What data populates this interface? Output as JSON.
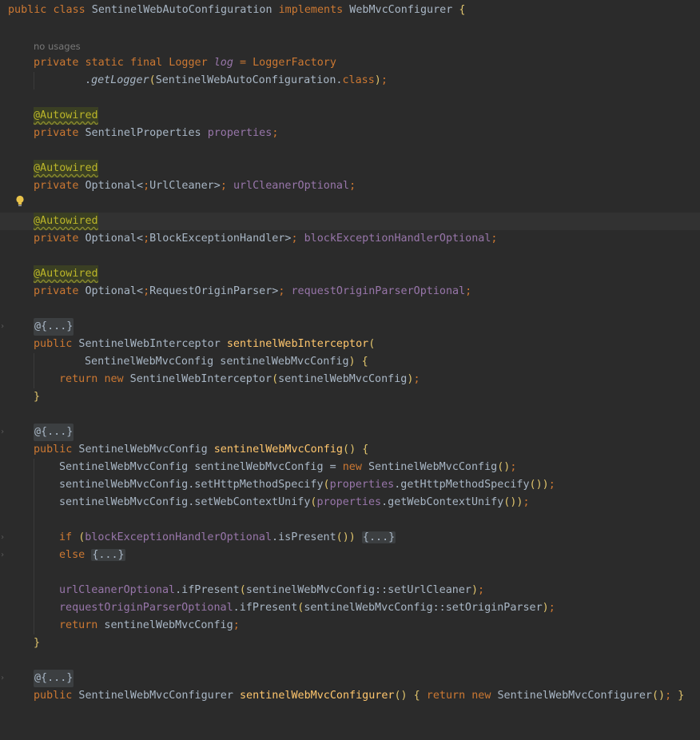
{
  "editor": {
    "usage_hint": "no usages",
    "lines": [
      "public class SentinelWebAutoConfiguration implements WebMvcConfigurer {",
      "private static final Logger log = LoggerFactory",
      ".getLogger(SentinelWebAutoConfiguration.class);",
      "@Autowired",
      "private SentinelProperties properties;",
      "private Optional<UrlCleaner> urlCleanerOptional;",
      "private Optional<BlockExceptionHandler> blockExceptionHandlerOptional;",
      "private Optional<RequestOriginParser> requestOriginParserOptional;",
      "@{...}",
      "public SentinelWebInterceptor sentinelWebInterceptor(",
      "SentinelWebMvcConfig sentinelWebMvcConfig) {",
      "return new SentinelWebInterceptor(sentinelWebMvcConfig);",
      "}",
      "public SentinelWebMvcConfig sentinelWebMvcConfig() {",
      "SentinelWebMvcConfig sentinelWebMvcConfig = new SentinelWebMvcConfig();",
      "sentinelWebMvcConfig.setHttpMethodSpecify(properties.getHttpMethodSpecify());",
      "sentinelWebMvcConfig.setWebContextUnify(properties.getWebContextUnify());",
      "if (blockExceptionHandlerOptional.isPresent()) {...}",
      "else {...}",
      "urlCleanerOptional.ifPresent(sentinelWebMvcConfig::setUrlCleaner);",
      "requestOriginParserOptional.ifPresent(sentinelWebMvcConfig::setOriginParser);",
      "return sentinelWebMvcConfig;",
      "public SentinelWebMvcConfigurer sentinelWebMvcConfigurer() { return new SentinelWebMvcConfigurer(); }"
    ]
  },
  "colors": {
    "background": "#2b2b2b",
    "keyword": "#cc7832",
    "method": "#ffc66d",
    "field": "#9876aa",
    "annotation": "#bbb529"
  },
  "icons": {
    "intention_bulb": "lightbulb-icon",
    "fold_marker": "fold-chevron-icon"
  }
}
